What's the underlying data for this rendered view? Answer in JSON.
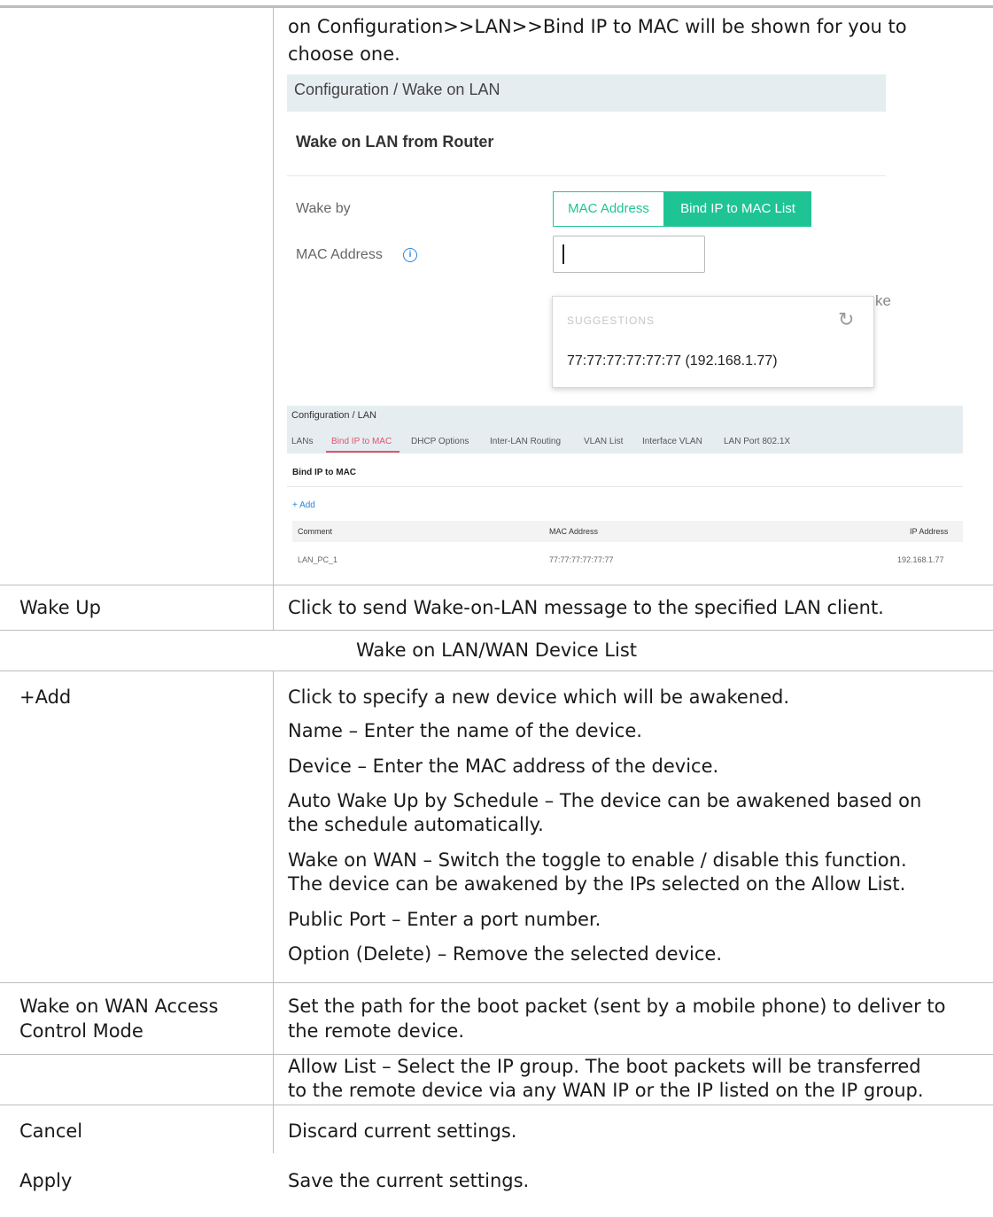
{
  "first_row": {
    "description_lines": [
      "on Configuration>>LAN>>Bind IP to MAC will be shown for you to",
      "choose one."
    ]
  },
  "screenshot_wol": {
    "breadcrumb": "Configuration / Wake on LAN",
    "heading": "Wake on LAN from Router",
    "wake_by_label": "Wake by",
    "wake_by_options": [
      "MAC Address",
      "Bind IP to MAC List"
    ],
    "wake_by_selected": "Bind IP to MAC List",
    "mac_address_label": "MAC Address",
    "mac_input_value": "",
    "note_fragment": "ke",
    "suggestions_header": "SUGGESTIONS",
    "suggestion_item": "77:77:77:77:77:77  (192.168.1.77)"
  },
  "screenshot_lan": {
    "breadcrumb": "Configuration / LAN",
    "tabs": [
      "LANs",
      "Bind IP to MAC",
      "DHCP Options",
      "Inter-LAN Routing",
      "VLAN List",
      "Interface VLAN",
      "LAN Port 802.1X"
    ],
    "active_tab": "Bind IP to MAC",
    "heading": "Bind IP to MAC",
    "add_label": "+ Add",
    "columns": [
      "Comment",
      "MAC Address",
      "IP Address"
    ],
    "rows": [
      [
        "LAN_PC_1",
        "77:77:77:77:77:77",
        "192.168.1.77"
      ]
    ]
  },
  "rows": {
    "wake_up": {
      "label": "Wake Up",
      "description": "Click to send Wake-on-LAN message to the specified LAN client."
    },
    "section_title": "Wake on LAN/WAN Device List",
    "add": {
      "label": "+Add",
      "lines": [
        "Click to specify a new device which will be awakened.",
        "Name – Enter the name of the device.",
        "Device – Enter the MAC address of the device.",
        "Auto Wake Up by Schedule – The device can be awakened based on",
        "the schedule automatically.",
        "Wake on WAN – Switch the toggle to enable / disable this function.",
        "The device can be awakened by the IPs selected on the Allow List.",
        "Public Port – Enter a port number.",
        "Option (Delete) – Remove the selected device."
      ]
    },
    "access_control": {
      "label_lines": [
        "Wake on WAN Access",
        "Control Mode"
      ],
      "lines": [
        "Set the path for the boot packet (sent by a mobile phone) to deliver to",
        "the remote device.",
        "Allow List – Select the IP group. The boot packets will be transferred",
        "to the remote device via any WAN IP or the IP listed on the IP group."
      ]
    },
    "cancel": {
      "label": "Cancel",
      "description": "Discard current settings."
    },
    "apply": {
      "label": "Apply",
      "description": "Save the current settings."
    }
  },
  "colors": {
    "accent_green": "#1fc495",
    "active_tab_pink": "#e0526d",
    "link_blue": "#2a86d9",
    "header_band": "#e6edf1",
    "rule": "#bdbdbd"
  }
}
